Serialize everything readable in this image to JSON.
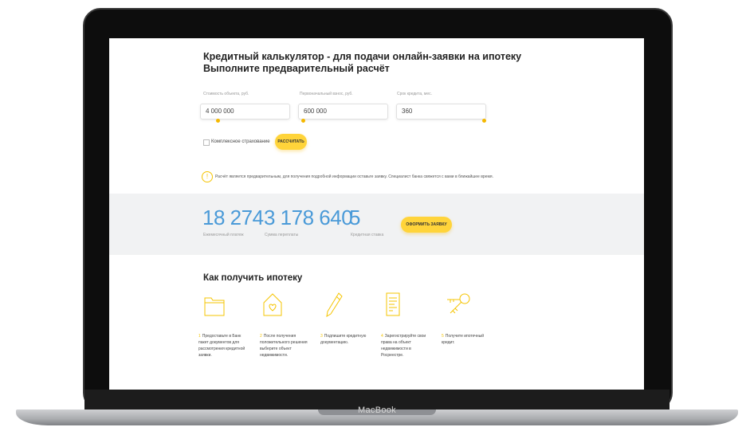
{
  "device": {
    "brand": "MacBook"
  },
  "page": {
    "title": "Кредитный калькулятор - для подачи онлайн-заявки на ипотеку Выполните предварительный расчёт"
  },
  "calculator": {
    "fields": [
      {
        "label": "Стоимость объекта, руб.",
        "value": "4 000 000",
        "slider_fraction": 0.15
      },
      {
        "label": "Первоначальный взнос, руб.",
        "value": "600 000",
        "slider_fraction": 0.0
      },
      {
        "label": "Срок кредита, мес.",
        "value": "360",
        "slider_fraction": 1.0
      }
    ],
    "insurance_checkbox_label": "Комплексное страхование",
    "insurance_checked": false,
    "calculate_button": "Рассчитать",
    "info_icon": "info-circle-icon",
    "info_text": "Расчёт является предварительным, для получения подробной информации оставьте заявку. Специалист банка свяжется с вами в ближайшее время."
  },
  "results": {
    "monthly_payment": {
      "value": "18 274",
      "label": "Ежемесячный платеж"
    },
    "overpayment": {
      "value": "3 178 640",
      "label": "Сумма переплаты"
    },
    "rate": {
      "value": "5",
      "label": "Кредитная ставка"
    },
    "apply_button": "Оформить заявку"
  },
  "how_to": {
    "title": "Как получить ипотеку",
    "steps": [
      {
        "num": "1",
        "icon": "folder-icon",
        "text": "Предоставьте в Банк пакет документов для рассмотрения кредитной заявки."
      },
      {
        "num": "2",
        "icon": "house-heart-icon",
        "text": "После получения положительного решения выберите объект недвижимости."
      },
      {
        "num": "3",
        "icon": "pen-icon",
        "text": "Подпишите кредитную документацию."
      },
      {
        "num": "4",
        "icon": "document-icon",
        "text": "Зарегистрируйте свои права на объект недвижимости в Росреестре."
      },
      {
        "num": "5",
        "icon": "keys-icon",
        "text": "Получите ипотечный кредит."
      }
    ]
  },
  "colors": {
    "accent_yellow": "#ffd43a",
    "result_blue": "#4a9ad8",
    "band_gray": "#f1f2f3"
  }
}
